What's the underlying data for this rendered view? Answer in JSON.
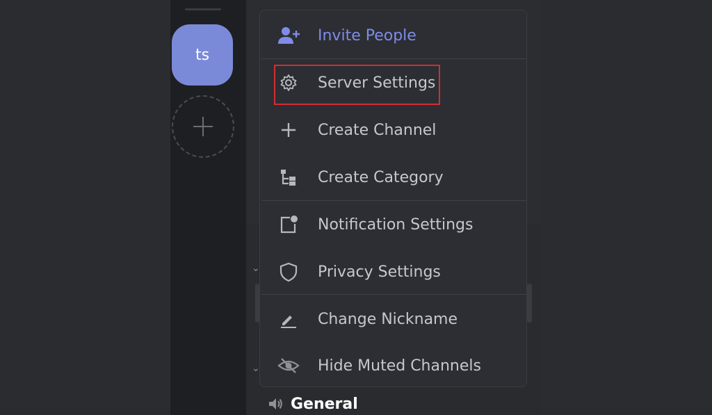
{
  "server_rail": {
    "server_initials": "ts"
  },
  "menu": {
    "items": [
      {
        "label": "Invite People",
        "icon": "add-person-icon"
      },
      {
        "label": "Server Settings",
        "icon": "gear-icon"
      },
      {
        "label": "Create Channel",
        "icon": "plus-icon"
      },
      {
        "label": "Create Category",
        "icon": "category-icon"
      },
      {
        "label": "Notification Settings",
        "icon": "notification-icon"
      },
      {
        "label": "Privacy Settings",
        "icon": "shield-icon"
      },
      {
        "label": "Change Nickname",
        "icon": "pencil-icon"
      },
      {
        "label": "Hide Muted Channels",
        "icon": "eye-off-icon"
      }
    ]
  },
  "channels": {
    "voice_channel": "General"
  },
  "colors": {
    "accent": "#7f8ce8",
    "server_icon": "#7b8ad8",
    "highlight_box": "#d32d35"
  }
}
